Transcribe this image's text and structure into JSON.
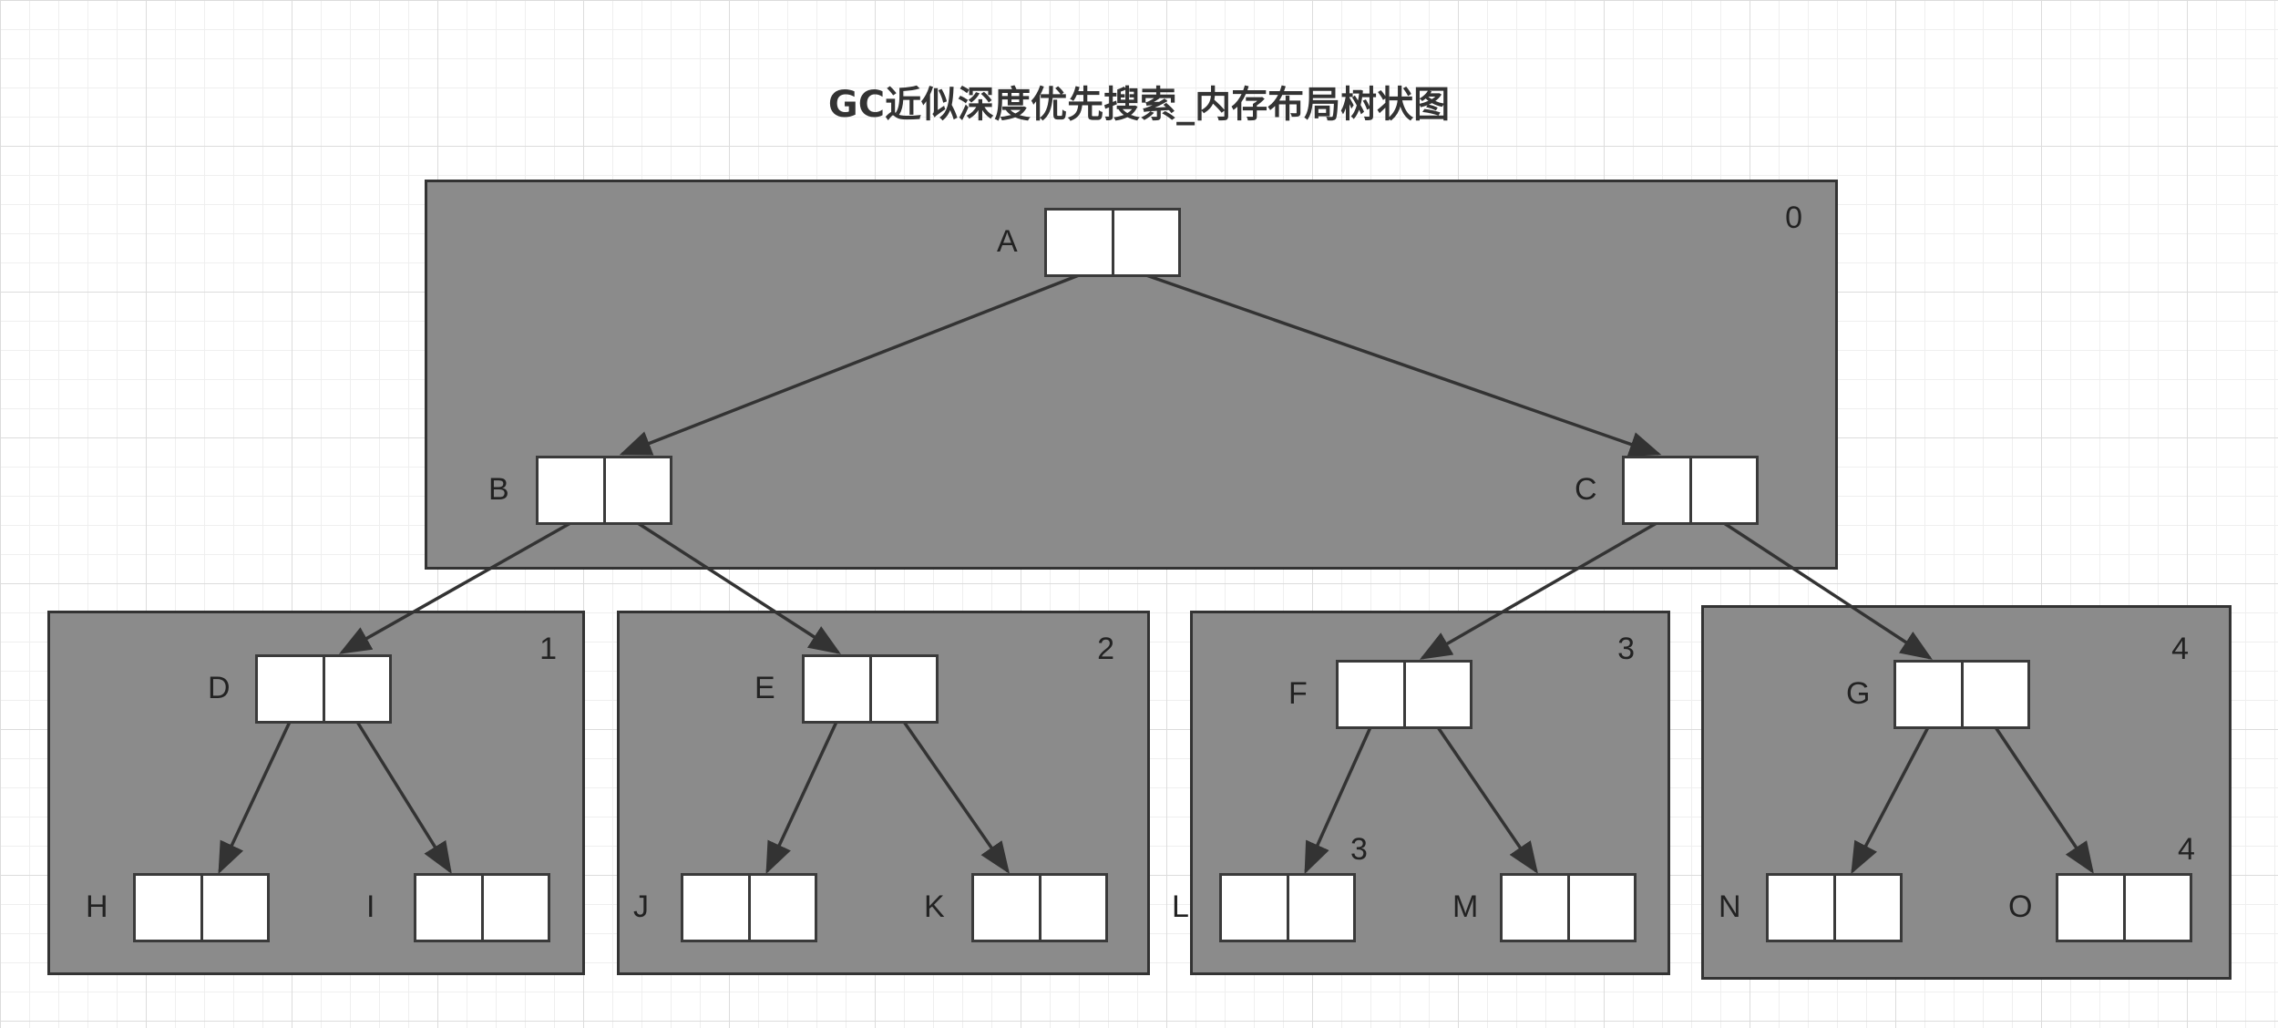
{
  "title": "GC近似深度优先搜索_内存布局树状图",
  "colors": {
    "region_fill": "#8b8b8b",
    "border": "#333333",
    "node_fill": "#ffffff",
    "edge": "#333333"
  },
  "regions": [
    {
      "number": "0",
      "nodes": [
        "A",
        "B",
        "C"
      ]
    },
    {
      "number": "1",
      "nodes": [
        "D",
        "H",
        "I"
      ]
    },
    {
      "number": "2",
      "nodes": [
        "E",
        "J",
        "K"
      ]
    },
    {
      "number": "3",
      "nodes": [
        "F",
        "L",
        "M"
      ]
    },
    {
      "number": "4",
      "nodes": [
        "G",
        "N",
        "O"
      ]
    }
  ],
  "nodes": [
    "A",
    "B",
    "C",
    "D",
    "E",
    "F",
    "G",
    "H",
    "I",
    "J",
    "K",
    "L",
    "M",
    "N",
    "O"
  ],
  "extra_labels": [
    "3",
    "4"
  ],
  "edges": [
    [
      "A",
      "B"
    ],
    [
      "A",
      "C"
    ],
    [
      "B",
      "D"
    ],
    [
      "B",
      "E"
    ],
    [
      "C",
      "F"
    ],
    [
      "C",
      "G"
    ],
    [
      "D",
      "H"
    ],
    [
      "D",
      "I"
    ],
    [
      "E",
      "J"
    ],
    [
      "E",
      "K"
    ],
    [
      "F",
      "L"
    ],
    [
      "F",
      "M"
    ],
    [
      "G",
      "N"
    ],
    [
      "G",
      "O"
    ]
  ]
}
